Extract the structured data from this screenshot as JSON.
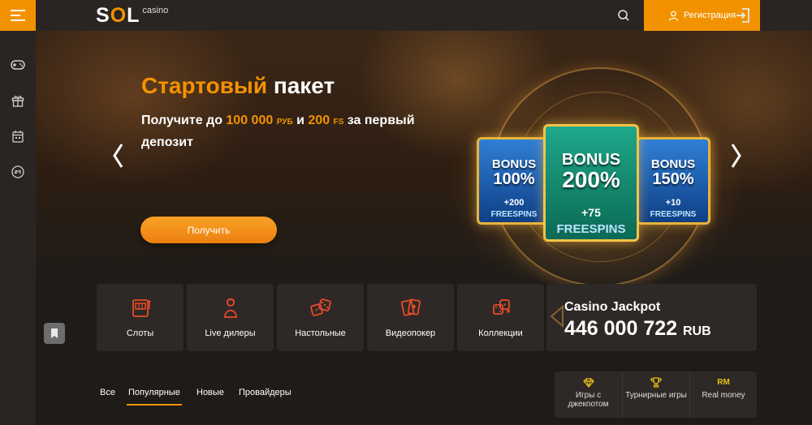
{
  "header": {
    "logo_main": "SOL",
    "logo_sub": "casino",
    "register_label": "Регистрация"
  },
  "hero": {
    "title_highlight": "Стартовый",
    "title_rest": "пакет",
    "subtitle": {
      "p1": "Получите до ",
      "amount": "100 000",
      "currency": "РУБ",
      "p2": " и ",
      "fs_amount": "200",
      "fs_label": "FS",
      "p3": " за первый депозит"
    },
    "cta_label": "Получить",
    "cards": [
      {
        "bonus": "BONUS",
        "percent": "100%",
        "extra": "+200",
        "freespins": "FREESPINS"
      },
      {
        "bonus": "BONUS",
        "percent": "200%",
        "extra": "+75",
        "freespins": "FREESPINS"
      },
      {
        "bonus": "BONUS",
        "percent": "150%",
        "extra": "+10",
        "freespins": "FREESPINS"
      }
    ]
  },
  "categories": [
    {
      "label": "Слоты",
      "icon": "slot-machine-icon"
    },
    {
      "label": "Live дилеры",
      "icon": "live-dealer-icon"
    },
    {
      "label": "Настольные",
      "icon": "dice-icon"
    },
    {
      "label": "Видеопокер",
      "icon": "cards-icon"
    },
    {
      "label": "Коллекции",
      "icon": "collection-icon"
    }
  ],
  "jackpot": {
    "title": "Casino Jackpot",
    "amount": "446 000 722",
    "currency": "RUB"
  },
  "tabs": [
    {
      "label": "Все",
      "active": false
    },
    {
      "label": "Популярные",
      "active": true
    },
    {
      "label": "Новые",
      "active": false
    },
    {
      "label": "Провайдеры",
      "active": false
    }
  ],
  "filters": [
    {
      "icon_text": "",
      "label": "Игры с джекпотом",
      "icon": "diamond-icon"
    },
    {
      "icon_text": "",
      "label": "Турнирные игры",
      "icon": "trophy-icon"
    },
    {
      "icon_text": "RM",
      "label": "Real money",
      "icon": "real-money-icon"
    }
  ],
  "colors": {
    "accent": "#f39200",
    "background": "#1e1b19",
    "panel": "#2e2926",
    "gold": "#e6c117"
  }
}
